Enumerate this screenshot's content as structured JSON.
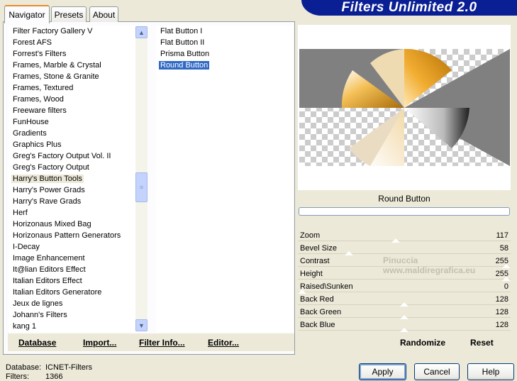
{
  "window": {
    "banner_title": "Filters Unlimited 2.0"
  },
  "tabs": [
    {
      "label": "Navigator",
      "active": true
    },
    {
      "label": "Presets",
      "active": false
    },
    {
      "label": "About",
      "active": false
    }
  ],
  "categories": [
    "Filter Factory Gallery V",
    "Forest AFS",
    "Forrest's Filters",
    "Frames, Marble & Crystal",
    "Frames, Stone & Granite",
    "Frames, Textured",
    "Frames, Wood",
    "Freeware filters",
    "FunHouse",
    "Gradients",
    "Graphics Plus",
    "Greg's Factory Output Vol. II",
    "Greg's Factory Output",
    "Harry's Button Tools",
    "Harry's Power Grads",
    "Harry's Rave Grads",
    "Herf",
    "Horizonaus Mixed Bag",
    "Horizonaus Pattern Generators",
    "I-Decay",
    "Image Enhancement",
    "It@lian Editors Effect",
    "Italian Editors Effect",
    "Italian Editors Generatore",
    "Jeux de lignes",
    "Johann's Filters",
    "kang 1"
  ],
  "selected_category": "Harry's Button Tools",
  "filters": [
    "Flat Button I",
    "Flat Button II",
    "Prisma Button",
    "Round Button"
  ],
  "selected_filter": "Round Button",
  "left_toolbar": {
    "database": "Database",
    "import": "Import...",
    "filter_info": "Filter Info...",
    "editor": "Editor..."
  },
  "preview": {
    "filter_name": "Round Button"
  },
  "params": [
    {
      "label": "Zoom",
      "value": "117",
      "level": 0.46
    },
    {
      "label": "Bevel Size",
      "value": "58",
      "level": 0.23
    },
    {
      "label": "Contrast",
      "value": "255",
      "level": 1.0
    },
    {
      "label": "Height",
      "value": "255",
      "level": 1.0
    },
    {
      "label": "Raised\\Sunken",
      "value": "0",
      "level": 0.0
    },
    {
      "label": "Back Red",
      "value": "128",
      "level": 0.5
    },
    {
      "label": "Back Green",
      "value": "128",
      "level": 0.5
    },
    {
      "label": "Back Blue",
      "value": "128",
      "level": 0.5
    }
  ],
  "right_toolbar": {
    "randomize": "Randomize",
    "reset": "Reset"
  },
  "watermark": {
    "line1": "Pinuccia",
    "line2": "www.maldiregrafica.eu"
  },
  "status": {
    "database_label": "Database:",
    "database_value": "ICNET-Filters",
    "filters_label": "Filters:",
    "filters_value": "1366"
  },
  "buttons": {
    "apply": "Apply",
    "cancel": "Cancel",
    "help": "Help"
  }
}
